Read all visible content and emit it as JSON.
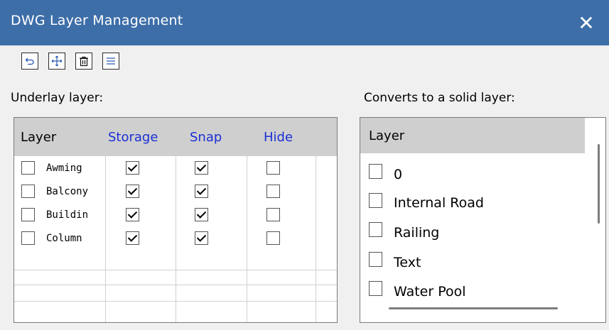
{
  "window": {
    "title": "DWG Layer Management",
    "close_glyph": "✕"
  },
  "toolbar": {
    "buttons": [
      "undo-icon",
      "move-icon",
      "delete-icon",
      "menu-icon"
    ]
  },
  "left_panel": {
    "label": "Underlay layer:",
    "columns": [
      "Layer",
      "Storage",
      "Snap",
      "Hide"
    ],
    "rows": [
      {
        "name": "Awming",
        "selected": false,
        "storage": true,
        "snap": true,
        "hide": false
      },
      {
        "name": "Balcony",
        "selected": false,
        "storage": true,
        "snap": true,
        "hide": false
      },
      {
        "name": "Buildin",
        "selected": false,
        "storage": true,
        "snap": true,
        "hide": false
      },
      {
        "name": "Column",
        "selected": false,
        "storage": true,
        "snap": true,
        "hide": false
      }
    ]
  },
  "right_panel": {
    "label": "Converts to a solid layer:",
    "column": "Layer",
    "items": [
      "0",
      "Internal Road",
      "Railing",
      "Text",
      "Water Pool"
    ]
  },
  "colors": {
    "titlebar": "#3d6ea8",
    "header_bg": "#cfcfcf",
    "blue_header": "#1a2fd6"
  }
}
